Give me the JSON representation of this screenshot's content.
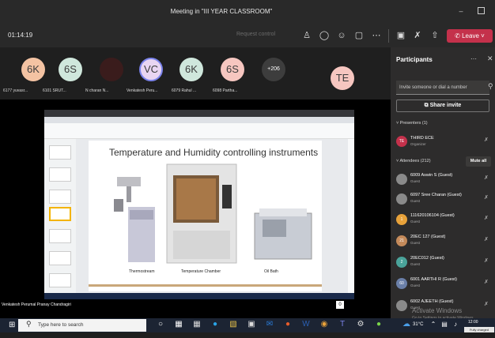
{
  "window": {
    "title": "Meeting in \"III YEAR CLASSROOM\""
  },
  "toolbar": {
    "timer": "01:14:19",
    "request_control": "Request control",
    "leave_label": "Leave"
  },
  "participants_strip": [
    {
      "initials": "6K",
      "name": "6177 yuvasr...",
      "color": "#f4c3a3"
    },
    {
      "initials": "6S",
      "name": "6101 SRUT...",
      "color": "#cfe7dc"
    },
    {
      "initials": "",
      "name": "N charan N...",
      "color": "#3a1c1c"
    },
    {
      "initials": "VC",
      "name": "Venkatesh Peru...",
      "color": "#e9d5f2"
    },
    {
      "initials": "6K",
      "name": "6079 Rahul ...",
      "color": "#cfe7dc"
    },
    {
      "initials": "6S",
      "name": "6098 Partha...",
      "color": "#f6c6c0"
    },
    {
      "initials": "+206",
      "name": "",
      "color": "#3d3d3d"
    }
  ],
  "presenter_avatar": {
    "initials": "TE",
    "color": "#f6c6c0"
  },
  "shared_screen": {
    "slide_title": "Temperature and Humidity controlling instruments",
    "captions": [
      "Thermostream",
      "Temperature Chamber",
      "Oil Bath"
    ],
    "presenter_label": "Venkatesh Perumal Pranay Chandragiri"
  },
  "panel": {
    "title": "Participants",
    "invite_placeholder": "Invite someone or dial a number",
    "share_invite": "Share invite",
    "presenters_header": "Presenters (1)",
    "attendees_header": "Attendees (212)",
    "mute_all": "Mute all",
    "presenters": [
      {
        "initials": "TE",
        "name": "THIRD ECE",
        "role": "Organizer",
        "color": "#c4314b"
      }
    ],
    "attendees": [
      {
        "initials": "",
        "name": "6009 Aswin S (Guest)",
        "role": "Guest",
        "color": "#8a8a8a"
      },
      {
        "initials": "",
        "name": "6097 Sree Charan (Guest)",
        "role": "Guest",
        "color": "#8a8a8a"
      },
      {
        "initials": "1",
        "name": "111620106104 (Guest)",
        "role": "Guest",
        "color": "#e8a23a"
      },
      {
        "initials": "21",
        "name": "20EC 127 (Guest)",
        "role": "Guest",
        "color": "#c48a5a"
      },
      {
        "initials": "2",
        "name": "20EC012 (Guest)",
        "role": "Guest",
        "color": "#4aa39a"
      },
      {
        "initials": "60",
        "name": "6001 AARTHI R (Guest)",
        "role": "Guest",
        "color": "#6a7fa8"
      },
      {
        "initials": "",
        "name": "6002 AJEETH (Guest)",
        "role": "Guest",
        "color": "#8a8a8a"
      }
    ],
    "watermark_title": "Activate Windows",
    "watermark_sub": "Go to Settings to activate Windows."
  },
  "taskbar": {
    "search_placeholder": "Type here to search",
    "temperature": "31°C",
    "time": "12:00",
    "battery_tooltip": "Fully charged (100%)"
  }
}
